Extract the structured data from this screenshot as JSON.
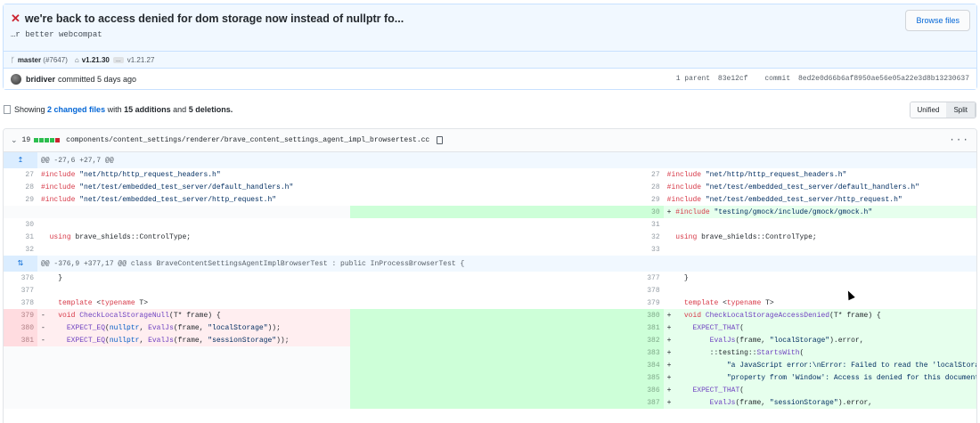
{
  "commit": {
    "title": "we're back to access denied for dom storage now instead of nullptr fo...",
    "description": "…r better webcompat",
    "browse_files": "Browse files",
    "branch": "master",
    "pr": "(#7647)",
    "tag_from": "v1.21.30",
    "tag_sep": "...",
    "tag_to": "v1.21.27",
    "author": "bridiver",
    "committed_text": "committed 5 days ago",
    "parent_label": "1 parent",
    "parent_sha": "83e12cf",
    "commit_label": "commit",
    "commit_sha": "8ed2e0d66b6af8950ae56e05a22e3d8b13230637"
  },
  "summary": {
    "showing": "Showing",
    "changed_files": "2 changed files",
    "with": "with",
    "additions": "15 additions",
    "and": "and",
    "deletions": "5 deletions.",
    "unified": "Unified",
    "split": "Split"
  },
  "file": {
    "changes": "19",
    "path": "components/content_settings/renderer/brave_content_settings_agent_impl_browsertest.cc"
  },
  "hunks": {
    "h1": "@@ -27,6 +27,7 @@",
    "h2": "@@ -376,9 +377,17 @@ class BraveContentSettingsAgentImplBrowserTest : public InProcessBrowserTest {"
  },
  "colors": {
    "accent": "#0366d6",
    "deletion": "#ffeef0",
    "addition": "#e6ffed"
  }
}
